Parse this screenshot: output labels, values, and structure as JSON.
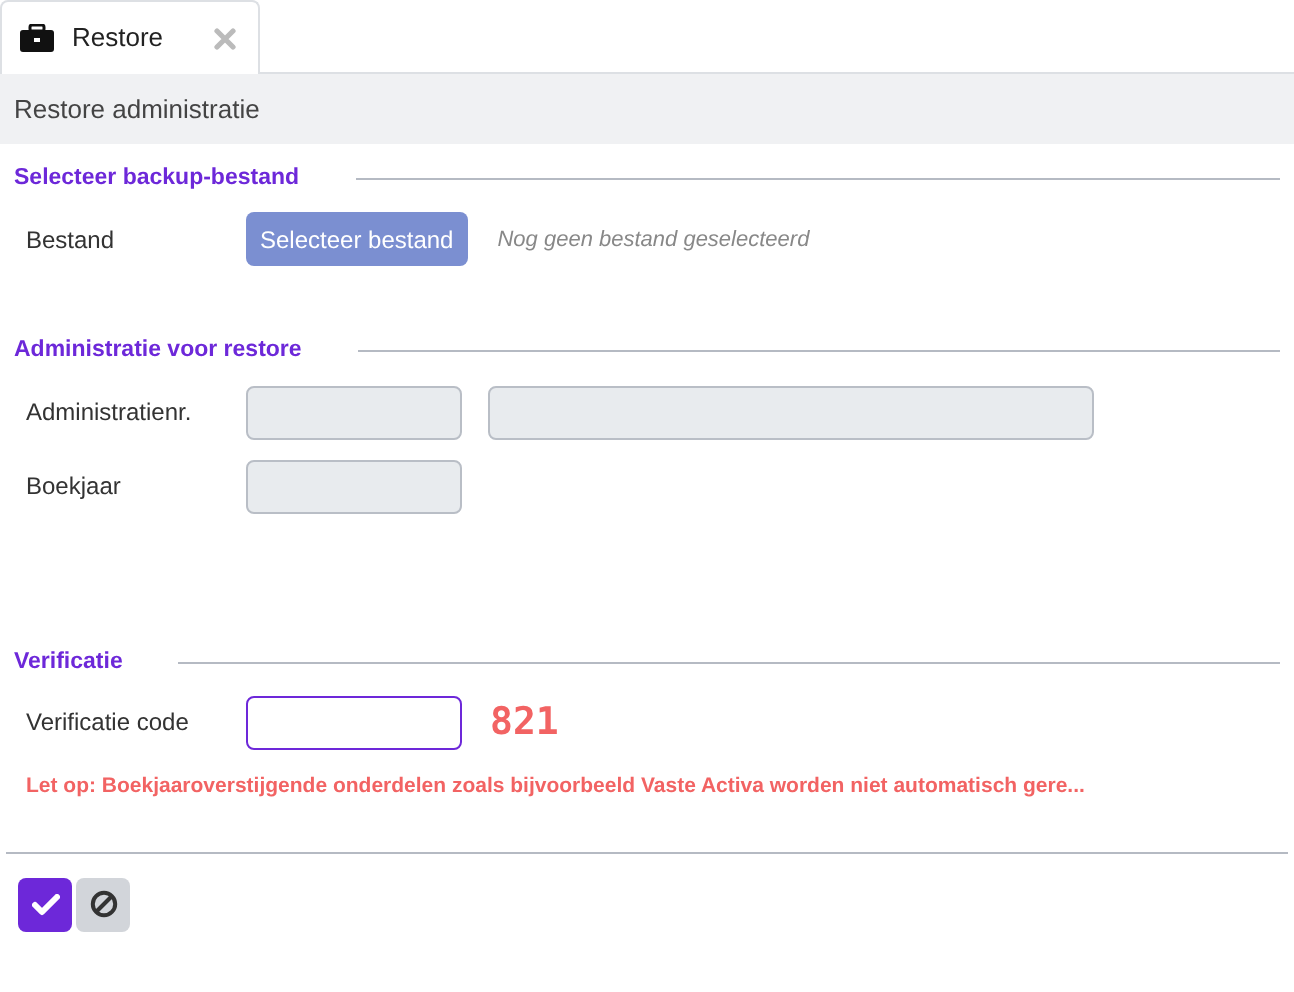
{
  "tabs": [
    {
      "label": "Restore",
      "selected": true,
      "closable": true
    }
  ],
  "page_title": "Restore administratie",
  "sections": [
    {
      "title": "Selecteer backup-bestand",
      "rows": [
        {
          "label": "Bestand",
          "kind": "file",
          "button": "Selecteer bestand",
          "note": "Nog geen bestand geselecteerd"
        }
      ]
    },
    {
      "title": "Administratie voor restore",
      "rows": [
        {
          "label": "Administratienr.",
          "kind": "fields",
          "fields": [
            {
              "kind": "short",
              "disabled": true
            },
            {
              "kind": "long",
              "disabled": true
            }
          ]
        },
        {
          "label": "Boekjaar",
          "kind": "fields",
          "fields": [
            {
              "kind": "short",
              "disabled": true
            }
          ]
        }
      ]
    },
    {
      "title": "Verificatie",
      "rows": [
        {
          "label": "Verificatie code",
          "kind": "code",
          "fields": [
            {
              "kind": "short",
              "disabled": false
            }
          ],
          "code": "821"
        }
      ],
      "warning": "Let op: Boekjaaroverstijgende onderdelen zoals bijvoorbeeld Vaste Activa worden niet automatisch gere..."
    }
  ],
  "actions": [
    {
      "kind": "confirm"
    },
    {
      "kind": "cancel"
    }
  ]
}
